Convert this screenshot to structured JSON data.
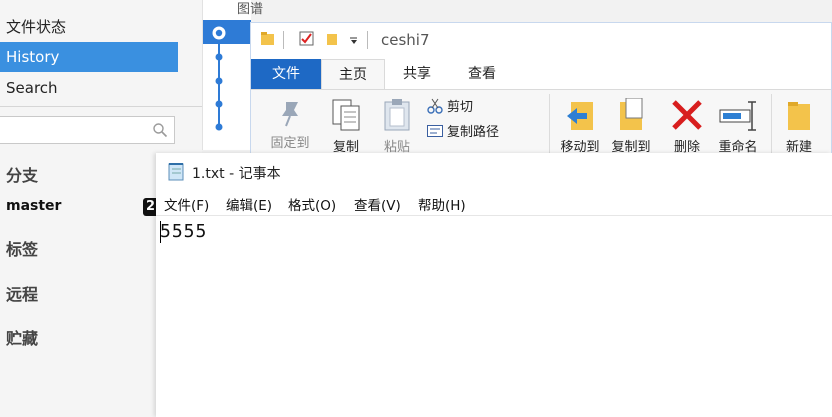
{
  "sidebar": {
    "nav": [
      {
        "label": "文件状态"
      },
      {
        "label": "History"
      },
      {
        "label": "Search"
      }
    ],
    "headers": {
      "branches": "分支",
      "tags": "标签",
      "remotes": "远程",
      "stashes": "贮藏"
    },
    "branch_name": "master",
    "branch_badge": "2"
  },
  "graph": {
    "label": "图谱"
  },
  "explorer": {
    "address": "ceshi7",
    "tabs": [
      {
        "label": "文件"
      },
      {
        "label": "主页"
      },
      {
        "label": "共享"
      },
      {
        "label": "查看"
      }
    ],
    "ribbon": {
      "pin": "固定到",
      "copy": "复制",
      "paste": "粘贴",
      "cut": "剪切",
      "copy_path": "复制路径",
      "move_to": "移动到",
      "copy_to": "复制到",
      "delete": "删除",
      "rename": "重命名",
      "new": "新建"
    }
  },
  "notepad": {
    "title": "1.txt - 记事本",
    "menus": [
      {
        "label": "文件(F)"
      },
      {
        "label": "编辑(E)"
      },
      {
        "label": "格式(O)"
      },
      {
        "label": "查看(V)"
      },
      {
        "label": "帮助(H)"
      }
    ],
    "content": "5555"
  },
  "colors": {
    "accent_blue": "#3a90e0",
    "ribbon_file_tab": "#1e69c5",
    "graph_node": "#2e7bd6",
    "delete_red": "#d81e1e"
  }
}
